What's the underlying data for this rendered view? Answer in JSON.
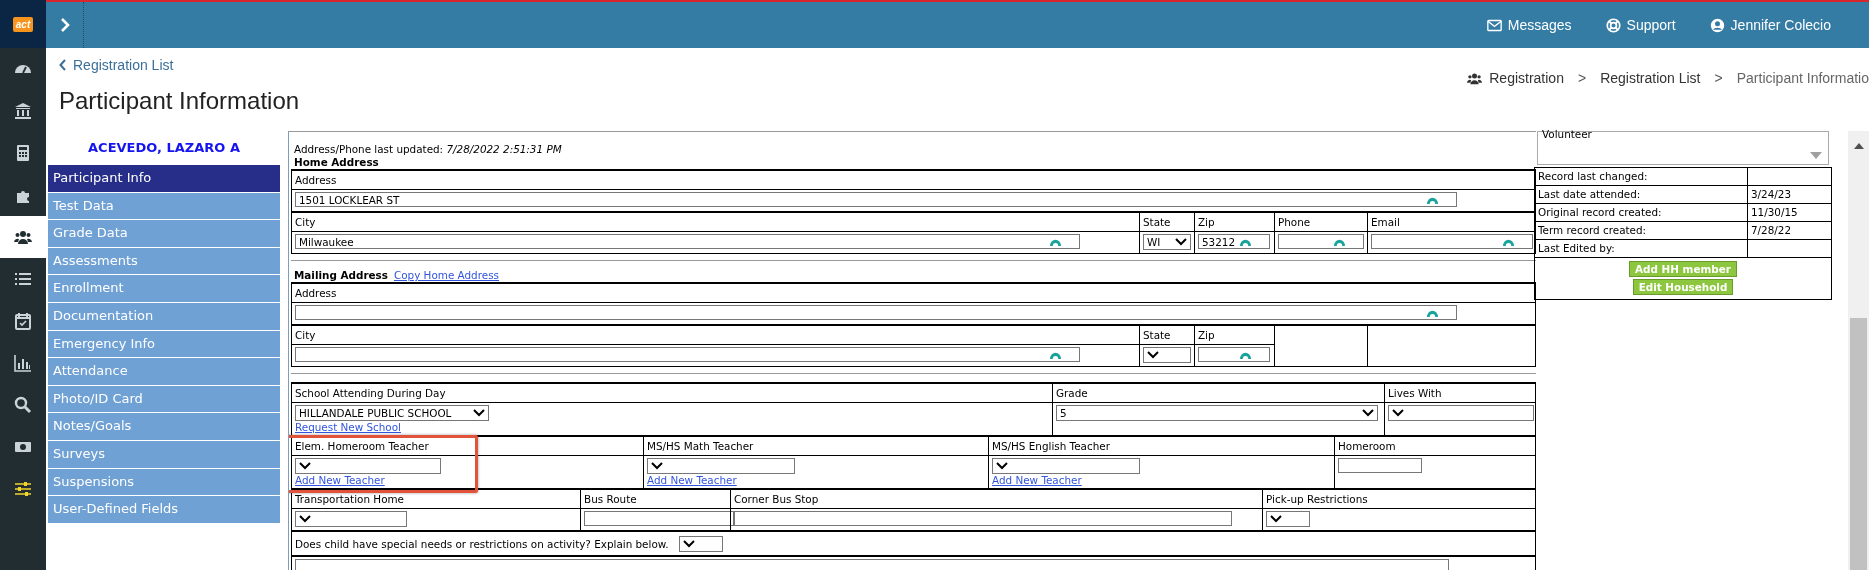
{
  "rail": {
    "logo": "act",
    "items": [
      {
        "kind": "gauge",
        "selected": false
      },
      {
        "kind": "bank",
        "selected": false
      },
      {
        "kind": "calculator",
        "selected": false
      },
      {
        "kind": "puzzle",
        "selected": false
      },
      {
        "kind": "users",
        "selected": true
      },
      {
        "kind": "list",
        "selected": false
      },
      {
        "kind": "calendar",
        "selected": false
      },
      {
        "kind": "chart",
        "selected": false
      },
      {
        "kind": "search",
        "selected": false
      },
      {
        "kind": "money",
        "selected": false
      },
      {
        "kind": "sliders",
        "selected": false
      }
    ]
  },
  "topbar": {
    "links": [
      {
        "kind": "envelope",
        "label": "Messages"
      },
      {
        "kind": "lifebuoy",
        "label": "Support"
      },
      {
        "kind": "user",
        "label": "Jennifer Colecio"
      }
    ]
  },
  "back_link": "Registration List",
  "title": "Participant Information",
  "breadcrumbs": {
    "separator": ">",
    "items": [
      "Registration",
      "Registration List",
      "Participant Informatio"
    ]
  },
  "sidebar": {
    "participant_name": "ACEVEDO, LAZARO A",
    "items": [
      {
        "label": "Participant Info",
        "selected": true
      },
      {
        "label": "Test Data",
        "selected": false
      },
      {
        "label": "Grade Data",
        "selected": false
      },
      {
        "label": "Assessments",
        "selected": false
      },
      {
        "label": "Enrollment",
        "selected": false
      },
      {
        "label": "Documentation",
        "selected": false
      },
      {
        "label": "Emergency Info",
        "selected": false
      },
      {
        "label": "Attendance",
        "selected": false
      },
      {
        "label": "Photo/ID Card",
        "selected": false
      },
      {
        "label": "Notes/Goals",
        "selected": false
      },
      {
        "label": "Surveys",
        "selected": false
      },
      {
        "label": "Suspensions",
        "selected": false
      },
      {
        "label": "User-Defined Fields",
        "selected": false
      }
    ]
  },
  "form": {
    "last_updated": {
      "label": "Address/Phone last updated:",
      "value": "7/28/2022 2:51:31 PM"
    },
    "sections": [
      {
        "heading": "Home Address",
        "rows": [
          [
            {
              "label": "Address",
              "field": {
                "kind": "text",
                "value": "1501 LOCKLEAR ST",
                "lookup": true
              }
            }
          ],
          [
            {
              "label": "City",
              "field": {
                "kind": "text",
                "value": "Milwaukee",
                "lookup": true
              }
            },
            {
              "label": "State",
              "field": {
                "kind": "select",
                "value": "WI"
              }
            },
            {
              "label": "Zip",
              "field": {
                "kind": "text",
                "value": "53212",
                "lookup": true
              }
            },
            {
              "label": "Phone",
              "field": {
                "kind": "text",
                "lookup": true
              }
            },
            {
              "label": "Email",
              "field": {
                "kind": "text",
                "lookup": true
              }
            }
          ]
        ]
      },
      {
        "heading": "Mailing Address",
        "link": "Copy Home Address",
        "rows": [
          [
            {
              "label": "Address",
              "field": {
                "kind": "text",
                "lookup": true
              }
            }
          ],
          [
            {
              "label": "City",
              "field": {
                "kind": "text",
                "lookup": true
              }
            },
            {
              "label": "State",
              "field": {
                "kind": "select"
              }
            },
            {
              "label": "Zip",
              "field": {
                "kind": "text",
                "lookup": true
              }
            },
            {},
            {}
          ]
        ]
      },
      {
        "rows": [
          [
            {
              "label": "School Attending During Day",
              "field": {
                "kind": "select",
                "value": "HILLANDALE PUBLIC SCHOOL"
              },
              "link": "Request New School"
            },
            {
              "label": "Grade",
              "field": {
                "kind": "select",
                "value": "5"
              }
            },
            {
              "label": "Lives With",
              "field": {
                "kind": "select"
              }
            }
          ],
          [
            {
              "label": "Elem. Homeroom Teacher",
              "field": {
                "kind": "select"
              },
              "link": "Add New Teacher",
              "highlighted": true
            },
            {
              "label": "MS/HS Math Teacher",
              "field": {
                "kind": "select"
              },
              "link": "Add New Teacher",
              "highlighted": false
            },
            {
              "label": "MS/HS English Teacher",
              "field": {
                "kind": "select"
              },
              "link": "Add New Teacher",
              "highlighted": false
            },
            {
              "label": "Homeroom",
              "field": {
                "kind": "text"
              }
            }
          ],
          [
            {
              "label": "Transportation Home",
              "field": {
                "kind": "select"
              }
            },
            {
              "label": "Bus Route",
              "field": {
                "kind": "text"
              }
            },
            {
              "label": "Corner Bus Stop",
              "field": {
                "kind": "text"
              }
            },
            {
              "label": "Pick-up Restrictions",
              "field": {
                "kind": "select"
              }
            }
          ]
        ],
        "question": {
          "label": "Does child have special needs or restrictions on activity? Explain below.",
          "field": {
            "kind": "select"
          }
        },
        "notes": {
          "kind": "textarea"
        }
      }
    ]
  },
  "side_panel": {
    "role": {
      "value": "Volunteer"
    },
    "info": [
      {
        "label": "Record last changed:"
      },
      {
        "label": "Last date attended:",
        "value": "3/24/23"
      },
      {
        "label": "Original record created:",
        "value": "11/30/15"
      },
      {
        "label": "Term record created:",
        "value": "7/28/22"
      },
      {
        "label": "Last Edited by:"
      }
    ],
    "buttons": [
      "Add HH member",
      "Edit Household"
    ]
  }
}
